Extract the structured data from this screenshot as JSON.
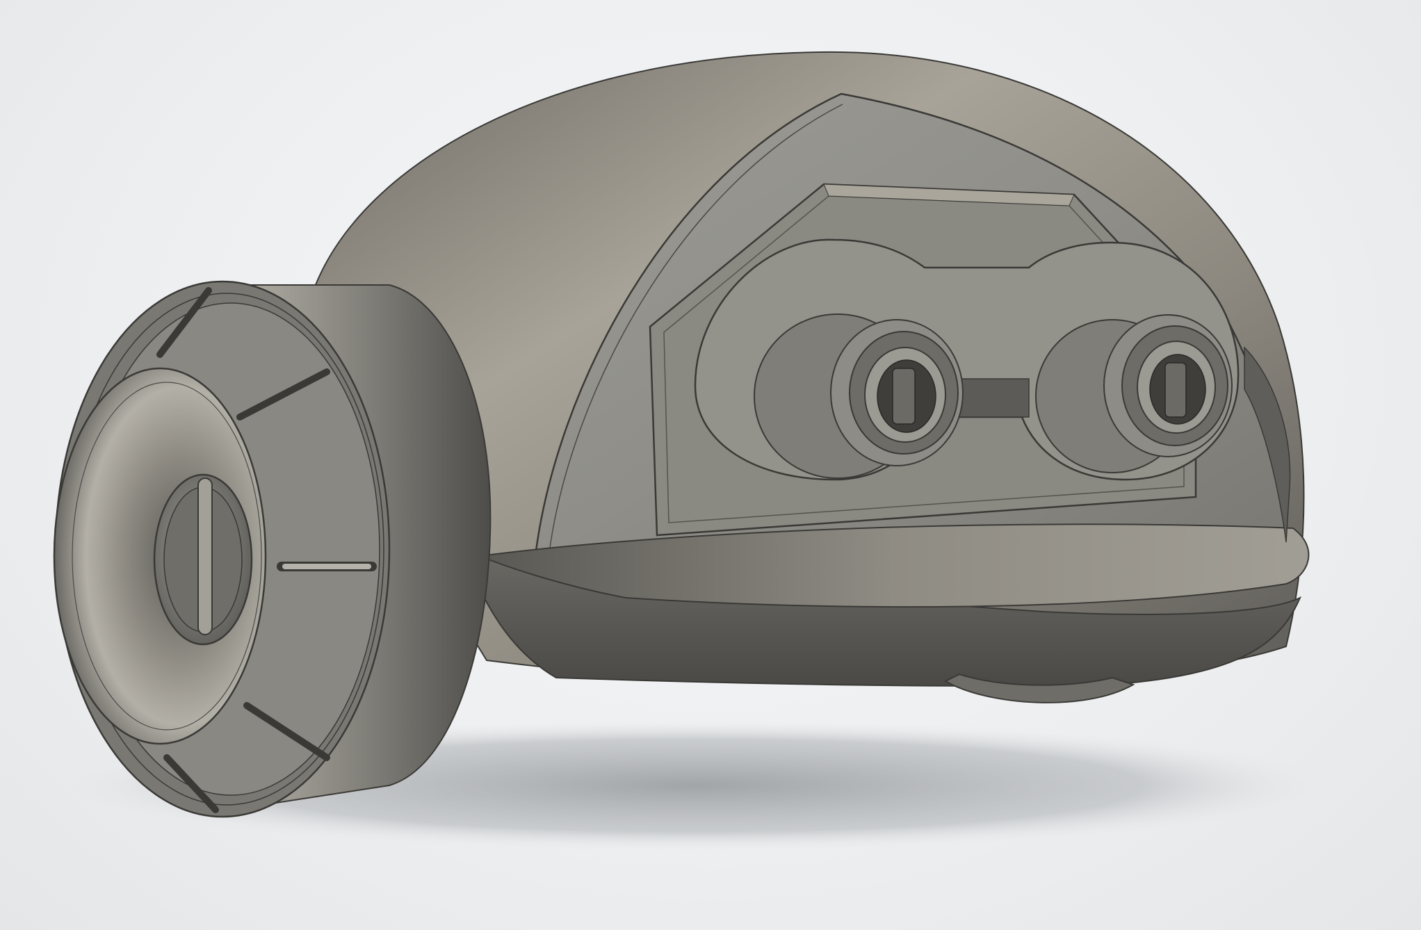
{
  "viewport": {
    "background": "#eef0f1",
    "model": {
      "name": "",
      "body_color": "#8b8880",
      "shadow_color": "#a6a8aa",
      "edge_color": "#3a3936"
    }
  }
}
